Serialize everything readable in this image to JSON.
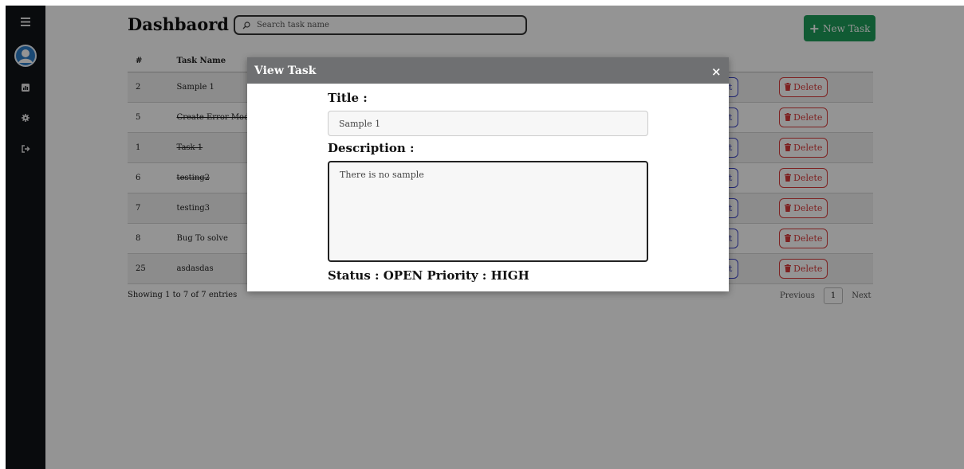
{
  "sidebar": {
    "icons": [
      "menu-icon",
      "avatar-icon",
      "dashboard-icon",
      "gear-icon",
      "logout-icon"
    ]
  },
  "header": {
    "title": "Dashbaord",
    "search_placeholder": "Search task name",
    "new_task_label": "New Task",
    "new_task_plus": "+"
  },
  "table": {
    "columns": {
      "num": "#",
      "name": "Task Name"
    },
    "rows": [
      {
        "num": "2",
        "name": "Sample 1",
        "done": false
      },
      {
        "num": "5",
        "name": "Create Error Module",
        "done": true
      },
      {
        "num": "1",
        "name": "Task 1",
        "done": true
      },
      {
        "num": "6",
        "name": "testing2",
        "done": true
      },
      {
        "num": "7",
        "name": "testing3",
        "done": false
      },
      {
        "num": "8",
        "name": "Bug To solve",
        "done": false
      },
      {
        "num": "25",
        "name": "asdasdas",
        "done": false
      }
    ],
    "edit_label": "Edit",
    "delete_label": "Delete"
  },
  "footer": {
    "entries_info": "Showing 1 to 7 of 7 entries",
    "prev_label": "Previous",
    "page": "1",
    "next_label": "Next"
  },
  "modal": {
    "title": "View Task",
    "close": "×",
    "title_label": "Title :",
    "title_value": "Sample 1",
    "description_label": "Description :",
    "description_value": "There is no sample",
    "status_line": "Status : OPEN Priority : HIGH"
  },
  "colors": {
    "sidebar_bg": "#111317",
    "new_task_bg": "#1e9e5a",
    "edit_color": "#3b42c4",
    "delete_color": "#d83a3a",
    "modal_header_bg": "#6f7072"
  }
}
